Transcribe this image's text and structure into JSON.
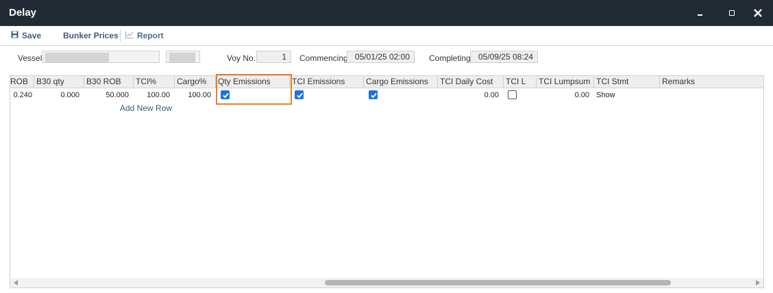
{
  "window": {
    "title": "Delay"
  },
  "toolbar": {
    "save": "Save",
    "bunker_prices": "Bunker Prices",
    "report": "Report"
  },
  "form": {
    "vessel_label": "Vessel",
    "voy_label": "Voy No.",
    "voy_value": "1",
    "commencing_label": "Commencing",
    "commencing_value": "05/01/25 02:00",
    "completing_label": "Completing",
    "completing_value": "05/09/25 08:24"
  },
  "grid": {
    "columns": [
      "ROB",
      "B30 qty",
      "B30 ROB",
      "TCI%",
      "Cargo%",
      "Qty Emissions",
      "TCI Emissions",
      "Cargo Emissions",
      "TCI Daily Cost",
      "TCI L",
      "TCI Lumpsum",
      "TCI Stmt",
      "Remarks"
    ],
    "rows": [
      {
        "rob": "0.240",
        "b30_qty": "0.000",
        "b30_rob": "50.000",
        "tci_pct": "100.00",
        "cargo_pct": "100.00",
        "qty_emissions": true,
        "tci_emissions": true,
        "cargo_emissions": true,
        "tci_daily_cost": "0.00",
        "tci_l": false,
        "tci_lumpsum": "0.00",
        "tci_stmt": "Show",
        "remarks": ""
      }
    ],
    "add_row": "Add New Row"
  },
  "colors": {
    "titlebar": "#222b33",
    "highlight": "#f07c24",
    "checkbox": "#1a73e8",
    "link": "#3d5a7a"
  }
}
